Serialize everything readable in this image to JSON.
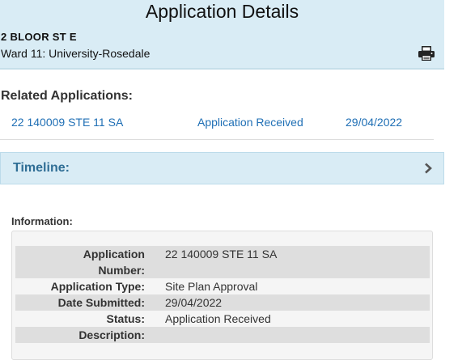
{
  "header": {
    "title": "Application Details",
    "address": "2 BLOOR ST E",
    "ward": "Ward 11: University-Rosedale",
    "print_icon": "printer-icon"
  },
  "related": {
    "heading": "Related Applications:",
    "items": [
      {
        "number": "22 140009 STE 11 SA",
        "status": "Application Received",
        "date": "29/04/2022"
      }
    ]
  },
  "timeline": {
    "label": "Timeline:",
    "icon": "chevron-right-icon"
  },
  "information": {
    "heading": "Information:",
    "rows": [
      {
        "label_line1": "Application",
        "label_line2": "Number:",
        "value": "22 140009 STE 11 SA"
      },
      {
        "label": "Application Type:",
        "value": "Site Plan Approval"
      },
      {
        "label": "Date Submitted:",
        "value": "29/04/2022"
      },
      {
        "label": "Status:",
        "value": "Application Received"
      },
      {
        "label": "Description:",
        "value": ""
      }
    ]
  },
  "colors": {
    "header_bg": "#d9ecf5",
    "link": "#1f6fb5",
    "timeline_text": "#2f6e95"
  }
}
